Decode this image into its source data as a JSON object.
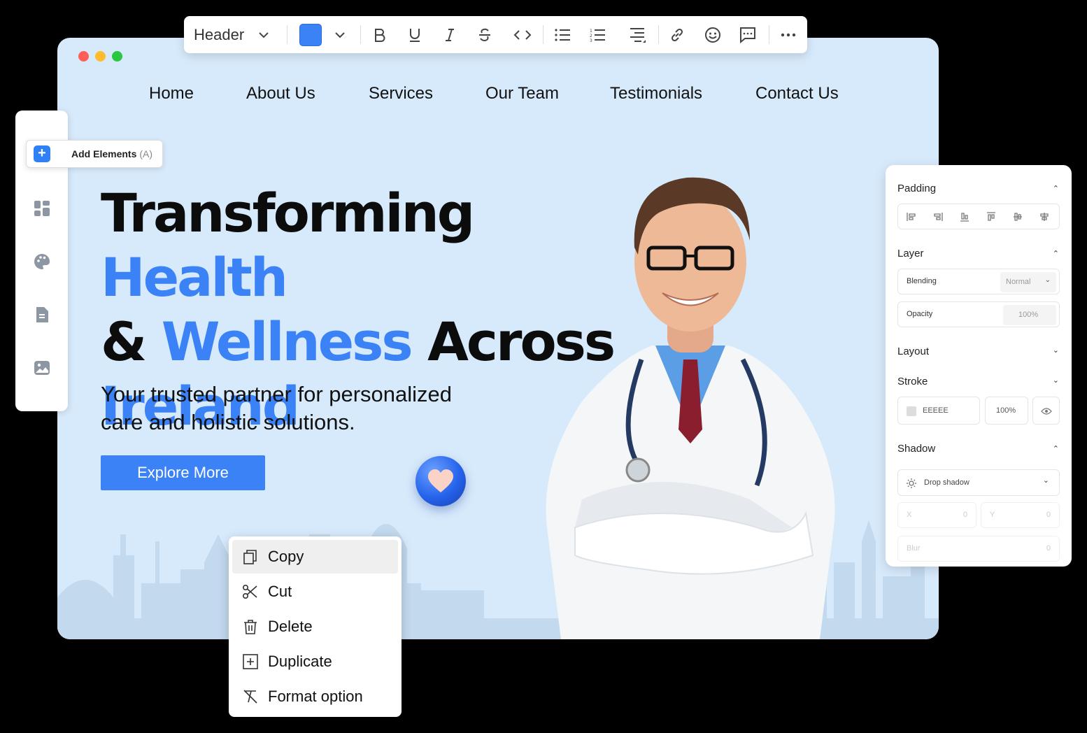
{
  "toolbar": {
    "style_select": "Header",
    "color_swatch": "#3b82f6",
    "icons": [
      "bold-icon",
      "underline-icon",
      "italic-icon",
      "strikethrough-icon",
      "code-icon",
      "bullet-list-icon",
      "numbered-list-icon",
      "align-icon",
      "link-icon",
      "emoji-icon",
      "comment-icon",
      "more-icon"
    ]
  },
  "window": {
    "traffic_colors": [
      "#ff5f57",
      "#febc2e",
      "#28c840"
    ]
  },
  "nav": {
    "items": [
      "Home",
      "About Us",
      "Services",
      "Our Team",
      "Testimonials",
      "Contact Us"
    ]
  },
  "hero": {
    "title_part1": "Transforming ",
    "title_part2": "Health",
    "title_part3": "& ",
    "title_part4": "Wellness",
    "title_part5": " Across",
    "title_part6": "Ireland",
    "subtitle": "Your trusted partner for personalized care and holistic solutions.",
    "cta": "Explore More"
  },
  "sidebar": {
    "add_elements": "Add Elements",
    "add_elements_shortcut": "(A)",
    "icons": [
      "layout-icon",
      "palette-icon",
      "document-icon",
      "image-icon"
    ]
  },
  "panel": {
    "padding": "Padding",
    "layer": "Layer",
    "blending_label": "Blending",
    "blending_value": "Normal",
    "opacity_label": "Opacity",
    "opacity_value": "100%",
    "layout": "Layout",
    "stroke": "Stroke",
    "stroke_color": "EEEEE",
    "stroke_opacity": "100%",
    "shadow": "Shadow",
    "shadow_type": "Drop shadow",
    "x_label": "X",
    "x_value": "0",
    "y_label": "Y",
    "y_value": "0",
    "blur_label": "Blur",
    "blur_value": "0"
  },
  "context_menu": {
    "items": [
      "Copy",
      "Cut",
      "Delete",
      "Duplicate",
      "Format option"
    ]
  }
}
